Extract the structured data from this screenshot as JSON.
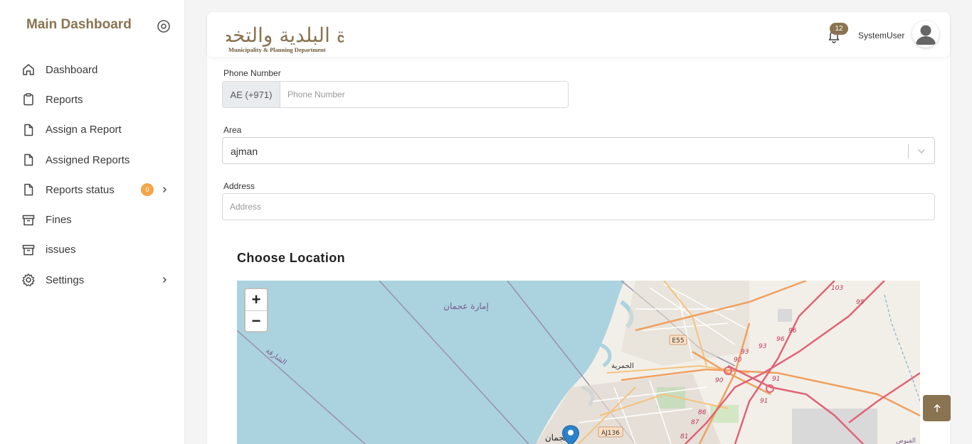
{
  "sidebar": {
    "brand": "Main Dashboard",
    "items": [
      {
        "label": "Dashboard",
        "icon": "home-icon"
      },
      {
        "label": "Reports",
        "icon": "clipboard-icon"
      },
      {
        "label": "Assign a Report",
        "icon": "document-icon"
      },
      {
        "label": "Assigned Reports",
        "icon": "document-icon"
      },
      {
        "label": "Reports status",
        "icon": "document-icon",
        "badge": "0"
      },
      {
        "label": "Fines",
        "icon": "archive-icon"
      },
      {
        "label": "issues",
        "icon": "archive-icon"
      },
      {
        "label": "Settings",
        "icon": "gear-icon"
      }
    ]
  },
  "header": {
    "logo_arabic": "دائرة البلدية والتخطيط",
    "logo_english": "Municipality & Planning Department",
    "notifications_count": "12",
    "username": "SystemUser"
  },
  "form": {
    "phone": {
      "label": "Phone Number",
      "prefix": "AE (+971)",
      "placeholder": "Phone Number",
      "value": ""
    },
    "area": {
      "label": "Area",
      "value": "ajman"
    },
    "address": {
      "label": "Address",
      "placeholder": "Address",
      "value": ""
    },
    "location_title": "Choose Location"
  },
  "map": {
    "zoom_in": "+",
    "zoom_out": "−",
    "labels": {
      "emirate": "إمارة عجمان",
      "sharjah": "الشارقة",
      "hamriyah": "الحمرية",
      "ajman": "عجمان",
      "e55": "E55",
      "aj136": "AJ136",
      "r103": "103",
      "r95": "95",
      "r96a": "96",
      "r96b": "96",
      "r93a": "93",
      "r93b": "93",
      "r90a": "90",
      "r90b": "90",
      "r91a": "91",
      "r91b": "91",
      "r86": "86",
      "r87": "87",
      "r81": "81",
      "qfl": "الفيوض"
    },
    "colors": {
      "sea": "#aad3df",
      "land": "#f2efe9",
      "motorway": "#e06377",
      "trunk": "#f0a060"
    }
  },
  "colors": {
    "accent": "#8a7350",
    "badge": "#f2a54a"
  }
}
